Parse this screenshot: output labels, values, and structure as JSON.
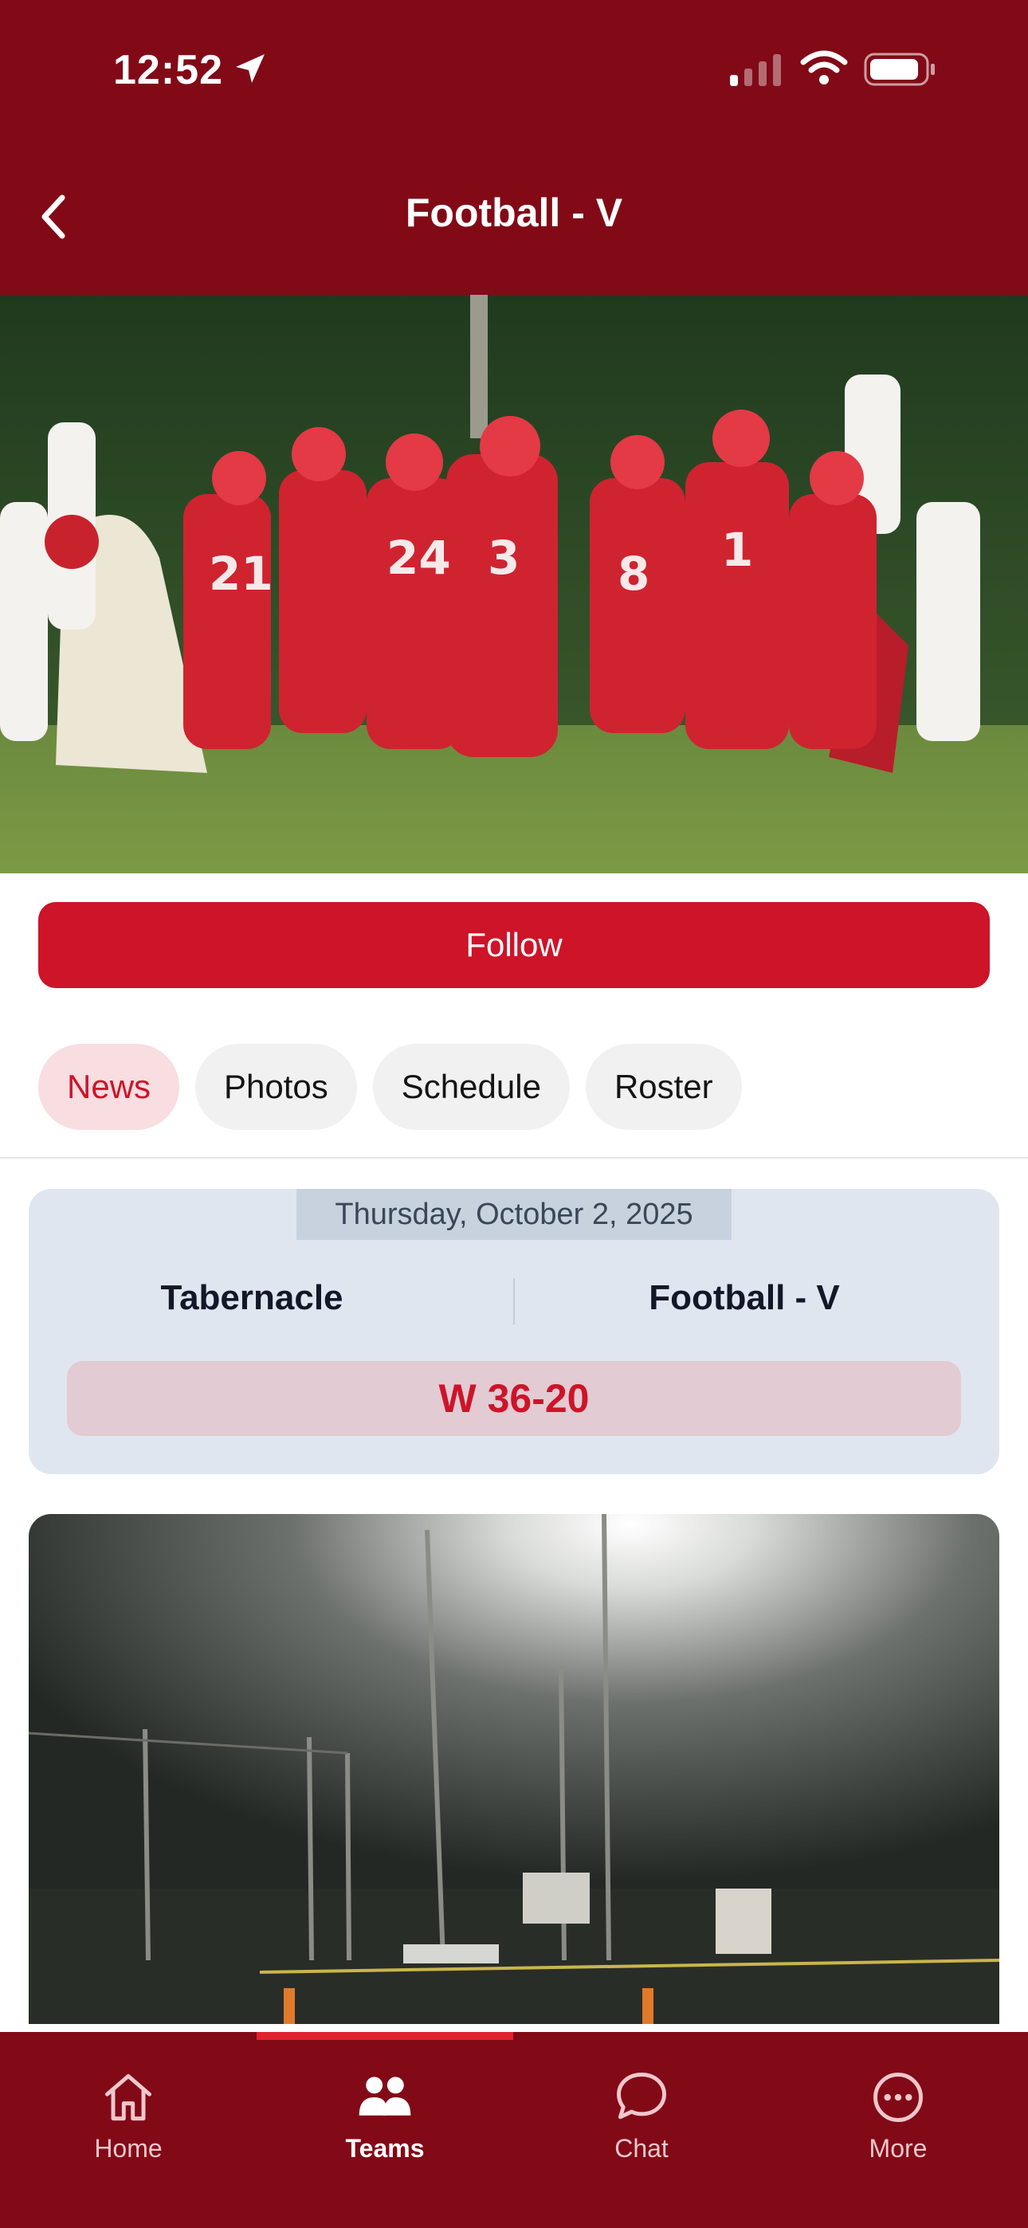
{
  "status_bar": {
    "time": "12:52"
  },
  "header": {
    "title": "Football - V"
  },
  "follow": {
    "label": "Follow"
  },
  "tabs": [
    {
      "label": "News",
      "active": true
    },
    {
      "label": "Photos",
      "active": false
    },
    {
      "label": "Schedule",
      "active": false
    },
    {
      "label": "Roster",
      "active": false
    }
  ],
  "game": {
    "date": "Thursday, October 2, 2025",
    "home_team": "Tabernacle",
    "away_team": "Football - V",
    "result": "W 36-20"
  },
  "nav": {
    "items": [
      {
        "label": "Home",
        "icon": "home-icon"
      },
      {
        "label": "Teams",
        "icon": "teams-icon",
        "active": true
      },
      {
        "label": "Chat",
        "icon": "chat-icon"
      },
      {
        "label": "More",
        "icon": "more-icon"
      }
    ]
  },
  "colors": {
    "brand_dark": "#820a17",
    "brand_accent": "#cd1429",
    "card_bg": "#e0e6ef"
  }
}
